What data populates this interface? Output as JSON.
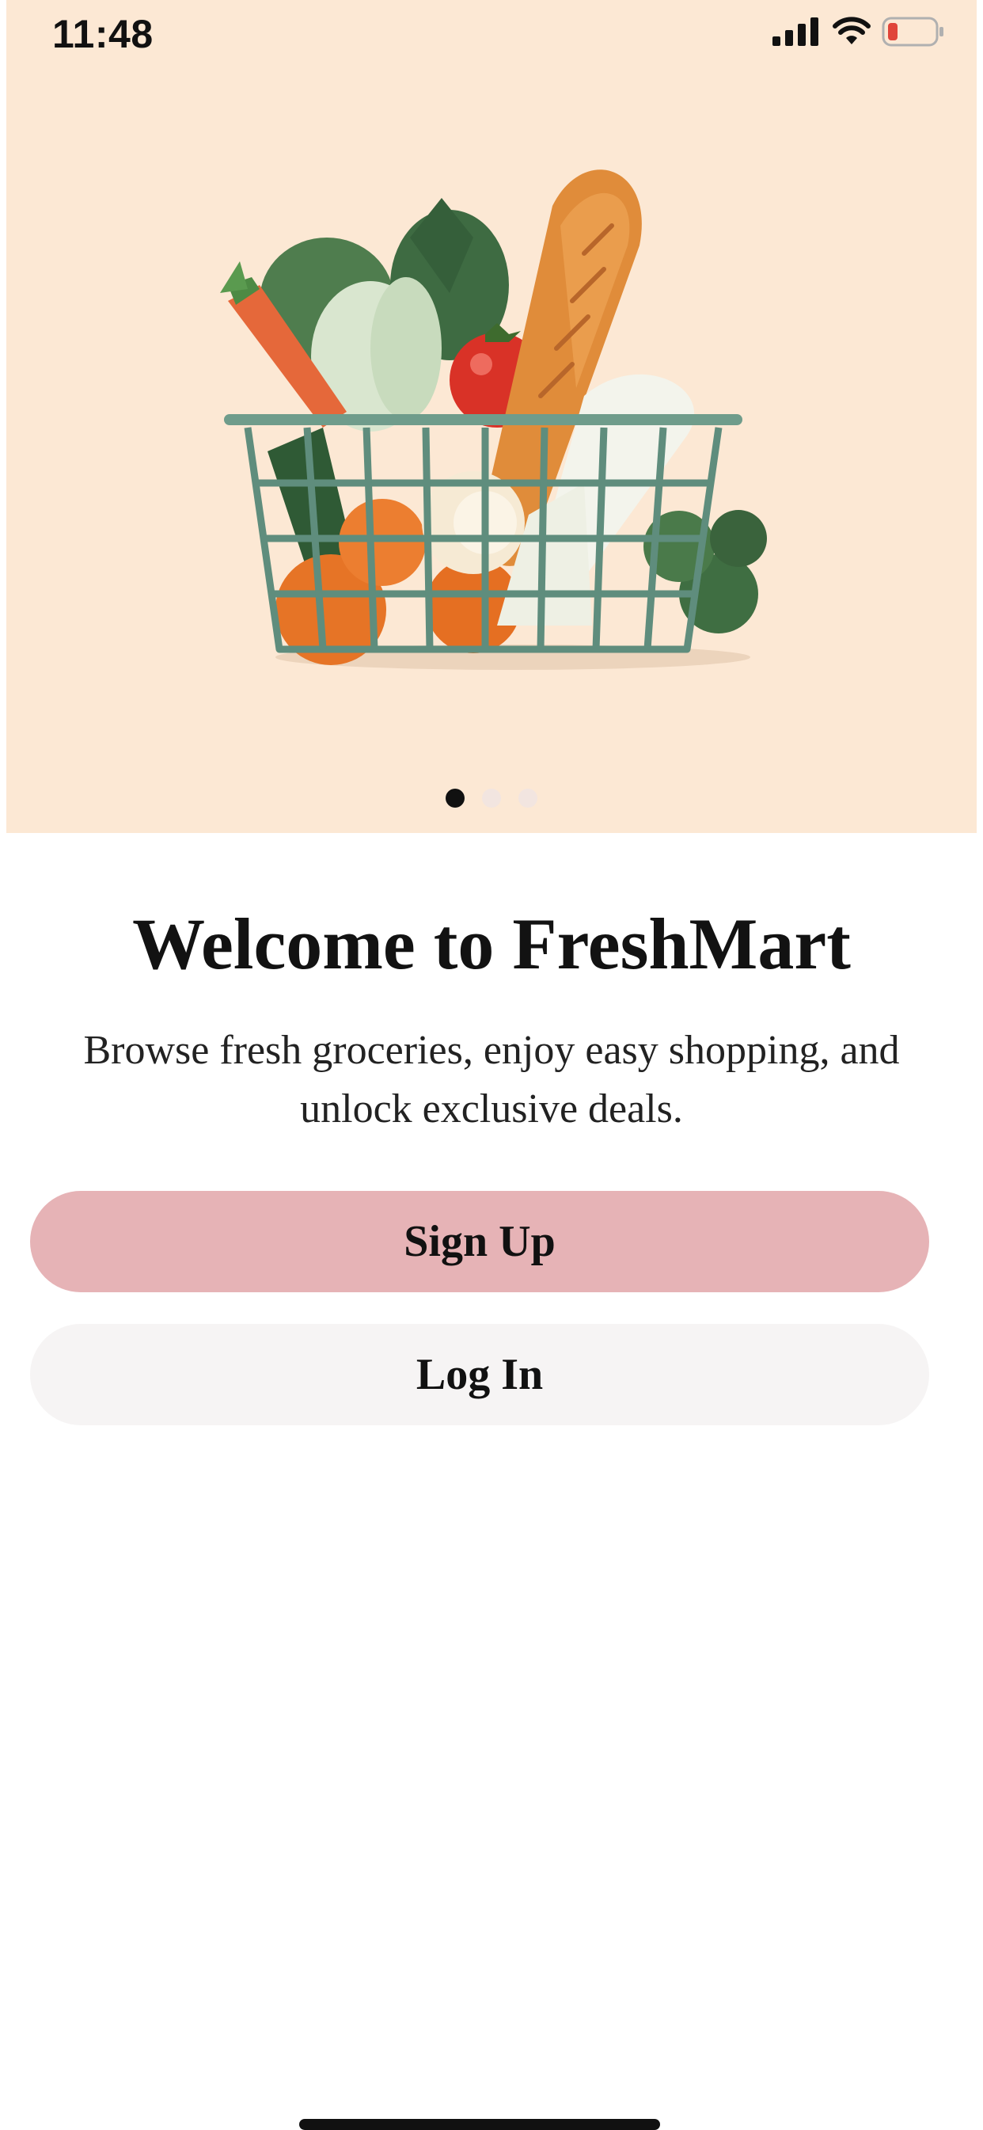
{
  "status_bar": {
    "time": "11:48",
    "icons": [
      "cellular-signal-icon",
      "wifi-icon",
      "battery-low-icon"
    ]
  },
  "hero": {
    "illustration": "grocery-basket-illustration",
    "carousel": {
      "total_pages": 3,
      "active_page": 1
    }
  },
  "welcome": {
    "title": "Welcome to FreshMart",
    "subtitle_line1": "Browse fresh groceries, enjoy easy shopping, and",
    "subtitle_line2": "unlock exclusive deals."
  },
  "actions": {
    "signup_label": "Sign Up",
    "login_label": "Log In"
  },
  "colors": {
    "hero_background": "#fce8d4",
    "signup_button": "#e6b3b6",
    "login_button": "#f6f4f4",
    "battery_low": "#e0453a"
  }
}
